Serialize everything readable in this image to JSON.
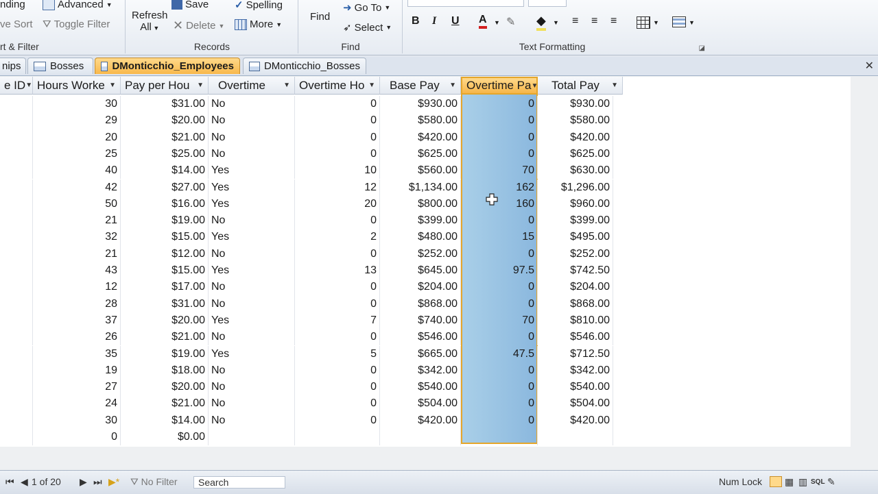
{
  "ribbon": {
    "sort_filter": {
      "label": "rt & Filter",
      "ending": "nding",
      "advanced": "Advanced",
      "save_sort": "ve Sort",
      "toggle_filter": "Toggle Filter"
    },
    "records": {
      "label": "Records",
      "refresh": "Refresh",
      "refresh_all": "All",
      "save": "Save",
      "delete": "Delete",
      "spelling": "Spelling",
      "more": "More"
    },
    "find": {
      "label": "Find",
      "find": "Find",
      "goto": "Go To",
      "select": "Select"
    },
    "text_formatting": {
      "label": "Text Formatting",
      "bold": "B",
      "italic": "I",
      "underline": "U",
      "font_color": "A"
    }
  },
  "tabs": [
    {
      "label": "nips",
      "active": false
    },
    {
      "label": "Bosses",
      "active": false
    },
    {
      "label": "DMonticchio_Employees",
      "active": true
    },
    {
      "label": "DMonticchio_Bosses",
      "active": false
    }
  ],
  "columns": [
    {
      "label": "e ID"
    },
    {
      "label": "Hours Worke"
    },
    {
      "label": "Pay per Hou"
    },
    {
      "label": "Overtime"
    },
    {
      "label": "Overtime Ho"
    },
    {
      "label": "Base Pay"
    },
    {
      "label": "Overtime Pa"
    },
    {
      "label": "Total Pay"
    }
  ],
  "rows": [
    [
      "30",
      "$31.00",
      "No",
      "0",
      "$930.00",
      "0",
      "$930.00"
    ],
    [
      "29",
      "$20.00",
      "No",
      "0",
      "$580.00",
      "0",
      "$580.00"
    ],
    [
      "20",
      "$21.00",
      "No",
      "0",
      "$420.00",
      "0",
      "$420.00"
    ],
    [
      "25",
      "$25.00",
      "No",
      "0",
      "$625.00",
      "0",
      "$625.00"
    ],
    [
      "40",
      "$14.00",
      "Yes",
      "10",
      "$560.00",
      "70",
      "$630.00"
    ],
    [
      "42",
      "$27.00",
      "Yes",
      "12",
      "$1,134.00",
      "162",
      "$1,296.00"
    ],
    [
      "50",
      "$16.00",
      "Yes",
      "20",
      "$800.00",
      "160",
      "$960.00"
    ],
    [
      "21",
      "$19.00",
      "No",
      "0",
      "$399.00",
      "0",
      "$399.00"
    ],
    [
      "32",
      "$15.00",
      "Yes",
      "2",
      "$480.00",
      "15",
      "$495.00"
    ],
    [
      "21",
      "$12.00",
      "No",
      "0",
      "$252.00",
      "0",
      "$252.00"
    ],
    [
      "43",
      "$15.00",
      "Yes",
      "13",
      "$645.00",
      "97.5",
      "$742.50"
    ],
    [
      "12",
      "$17.00",
      "No",
      "0",
      "$204.00",
      "0",
      "$204.00"
    ],
    [
      "28",
      "$31.00",
      "No",
      "0",
      "$868.00",
      "0",
      "$868.00"
    ],
    [
      "37",
      "$20.00",
      "Yes",
      "7",
      "$740.00",
      "70",
      "$810.00"
    ],
    [
      "26",
      "$21.00",
      "No",
      "0",
      "$546.00",
      "0",
      "$546.00"
    ],
    [
      "35",
      "$19.00",
      "Yes",
      "5",
      "$665.00",
      "47.5",
      "$712.50"
    ],
    [
      "19",
      "$18.00",
      "No",
      "0",
      "$342.00",
      "0",
      "$342.00"
    ],
    [
      "27",
      "$20.00",
      "No",
      "0",
      "$540.00",
      "0",
      "$540.00"
    ],
    [
      "24",
      "$21.00",
      "No",
      "0",
      "$504.00",
      "0",
      "$504.00"
    ],
    [
      "30",
      "$14.00",
      "No",
      "0",
      "$420.00",
      "0",
      "$420.00"
    ],
    [
      "0",
      "$0.00",
      "",
      "",
      "",
      "",
      ""
    ]
  ],
  "status": {
    "record": "1 of 20",
    "filter": "No Filter",
    "search": "Search",
    "numlock": "Num Lock",
    "view_sql": "SQL"
  },
  "colors": {
    "accent": "#f8b84b",
    "selected_column": "#a9cfe8"
  }
}
